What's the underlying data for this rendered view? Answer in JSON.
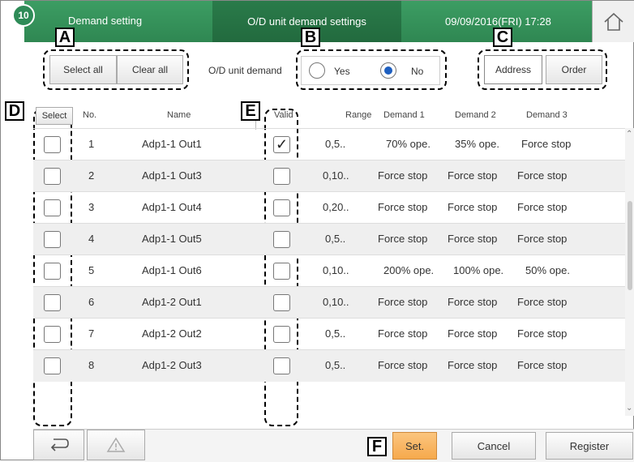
{
  "header": {
    "badge": "10",
    "title": "Demand setting",
    "center_title": "O/D unit demand settings",
    "datetime": "09/09/2016(FRI) 17:28"
  },
  "callouts": [
    "A",
    "B",
    "C",
    "D",
    "E",
    "F"
  ],
  "toolbar": {
    "select_all": "Select all",
    "clear_all": "Clear all",
    "demand_label": "O/D unit demand",
    "yes": "Yes",
    "no": "No",
    "selected_radio": "No",
    "address": "Address",
    "order": "Order"
  },
  "table": {
    "columns": [
      "Select",
      "No.",
      "Name",
      "Valid",
      "Range",
      "Demand 1",
      "Demand 2",
      "Demand 3"
    ],
    "rows": [
      {
        "no": "1",
        "name": "Adp1-1 Out1",
        "valid": true,
        "range": "0,5..",
        "d1": "70% ope.",
        "d2": "35% ope.",
        "d3": "Force stop"
      },
      {
        "no": "2",
        "name": "Adp1-1 Out3",
        "valid": false,
        "range": "0,10..",
        "d1": "Force stop",
        "d2": "Force stop",
        "d3": "Force stop"
      },
      {
        "no": "3",
        "name": "Adp1-1 Out4",
        "valid": false,
        "range": "0,20..",
        "d1": "Force stop",
        "d2": "Force stop",
        "d3": "Force stop"
      },
      {
        "no": "4",
        "name": "Adp1-1 Out5",
        "valid": false,
        "range": "0,5..",
        "d1": "Force stop",
        "d2": "Force stop",
        "d3": "Force stop"
      },
      {
        "no": "5",
        "name": "Adp1-1 Out6",
        "valid": false,
        "range": "0,10..",
        "d1": "200% ope.",
        "d2": "100% ope.",
        "d3": "50% ope."
      },
      {
        "no": "6",
        "name": "Adp1-2 Out1",
        "valid": false,
        "range": "0,10..",
        "d1": "Force stop",
        "d2": "Force stop",
        "d3": "Force stop"
      },
      {
        "no": "7",
        "name": "Adp1-2 Out2",
        "valid": false,
        "range": "0,5..",
        "d1": "Force stop",
        "d2": "Force stop",
        "d3": "Force stop"
      },
      {
        "no": "8",
        "name": "Adp1-2 Out3",
        "valid": false,
        "range": "0,5..",
        "d1": "Force stop",
        "d2": "Force stop",
        "d3": "Force stop"
      }
    ]
  },
  "footer": {
    "set": "Set.",
    "cancel": "Cancel",
    "register": "Register"
  },
  "colors": {
    "header_green": "#2f8752",
    "set_orange": "#f8b560",
    "radio_blue": "#1e5fbf"
  },
  "icons": [
    "home-icon",
    "back-arrow-icon",
    "warning-icon",
    "checkmark-icon",
    "scroll-up-icon",
    "scroll-down-icon"
  ]
}
